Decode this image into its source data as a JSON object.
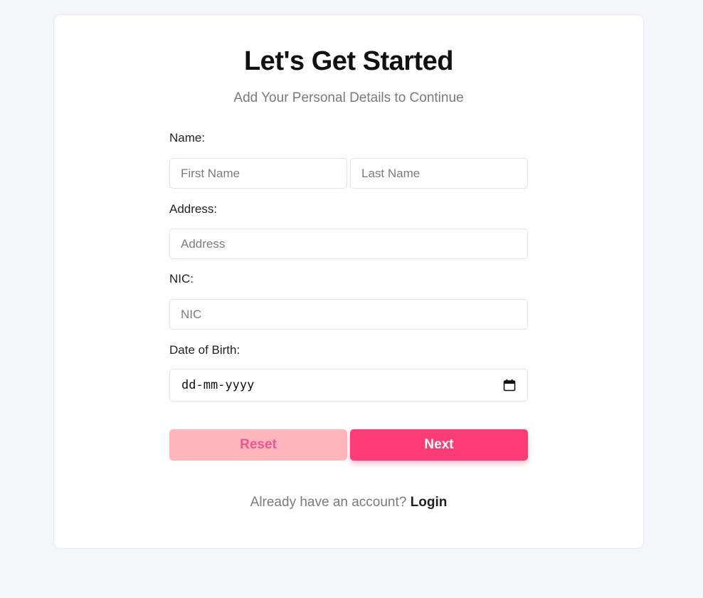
{
  "header": {
    "title": "Let's Get Started",
    "subtitle": "Add Your Personal Details to Continue"
  },
  "form": {
    "name_label": "Name:",
    "first_name_placeholder": "First Name",
    "last_name_placeholder": "Last Name",
    "address_label": "Address:",
    "address_placeholder": "Address",
    "nic_label": "NIC:",
    "nic_placeholder": "NIC",
    "dob_label": "Date of Birth:",
    "dob_value": "dd-mm-yyyy",
    "dob_icon": "calendar-icon"
  },
  "buttons": {
    "reset_label": "Reset",
    "next_label": "Next"
  },
  "footer": {
    "prompt": "Already have an account?",
    "login_label": "Login"
  },
  "colors": {
    "accent": "#fc3c74",
    "reset_bg": "#ffb6bd",
    "reset_text": "#f0568f",
    "page_bg": "#f5f6fa"
  }
}
